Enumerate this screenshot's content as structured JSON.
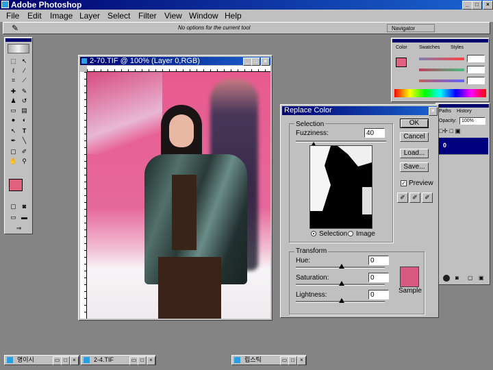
{
  "app": {
    "title": "Adobe Photoshop"
  },
  "menu": [
    "File",
    "Edit",
    "Image",
    "Layer",
    "Select",
    "Filter",
    "View",
    "Window",
    "Help"
  ],
  "options_bar": {
    "hint": "No options for the current tool",
    "palette_tab": "Navigator"
  },
  "document": {
    "title": "2-70.TIF @ 100% (Layer 0,RGB)"
  },
  "color_palette": {
    "tabs": [
      "Color",
      "Swatches",
      "Styles"
    ]
  },
  "layers_palette": {
    "tabs": [
      "Paths",
      "History"
    ],
    "opacity_label": "Opacity:",
    "opacity_value": "100%",
    "layer_name": "0"
  },
  "dialog": {
    "title": "Replace Color",
    "selection_group": "Selection",
    "fuzziness_label": "Fuzziness:",
    "fuzziness_value": "40",
    "radio_selection": "Selection",
    "radio_image": "Image",
    "ok": "OK",
    "cancel": "Cancel",
    "load": "Load...",
    "save": "Save...",
    "preview_label": "Preview",
    "preview_checked": true,
    "transform_group": "Transform",
    "hue_label": "Hue:",
    "hue_value": "0",
    "saturation_label": "Saturation:",
    "saturation_value": "0",
    "lightness_label": "Lightness:",
    "lightness_value": "0",
    "sample_label": "Sample",
    "sample_color": "#d85a80"
  },
  "colors": {
    "foreground": "#e0607e",
    "background": "#ffffff",
    "title_start": "#00006e",
    "title_end": "#1a64d0",
    "accent_pink": "#e85a8e"
  },
  "taskbar": [
    {
      "label": "명이시"
    },
    {
      "label": "2-4.TIF"
    },
    {
      "label": "립스틱"
    }
  ]
}
